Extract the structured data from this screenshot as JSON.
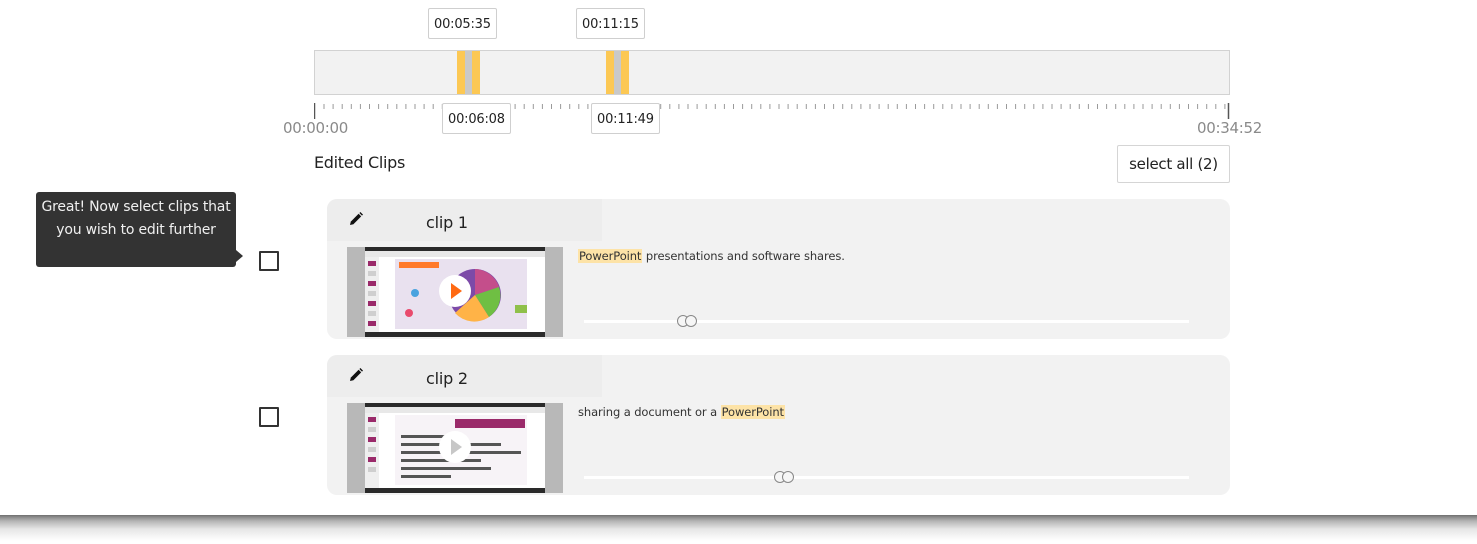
{
  "timeline": {
    "segment_starts": [
      "00:05:35",
      "00:11:15"
    ],
    "segment_ends": [
      "00:06:08",
      "00:11:49"
    ],
    "start_time": "00:00:00",
    "end_time": "00:34:52",
    "highlight_color": "#fcc854"
  },
  "clips_section": {
    "title": "Edited Clips",
    "select_all_label": "select all (2)"
  },
  "tooltip": {
    "text": "Great! Now select clips that you wish to edit further"
  },
  "clips": [
    {
      "title": "clip 1",
      "transcript_highlight": "PowerPoint",
      "transcript_rest": "presentations and software shares.",
      "slider_value": 0.17
    },
    {
      "title": "clip 2",
      "transcript_prefix": "sharing a document or a",
      "transcript_highlight": "PowerPoint",
      "slider_value": 0.33
    }
  ]
}
